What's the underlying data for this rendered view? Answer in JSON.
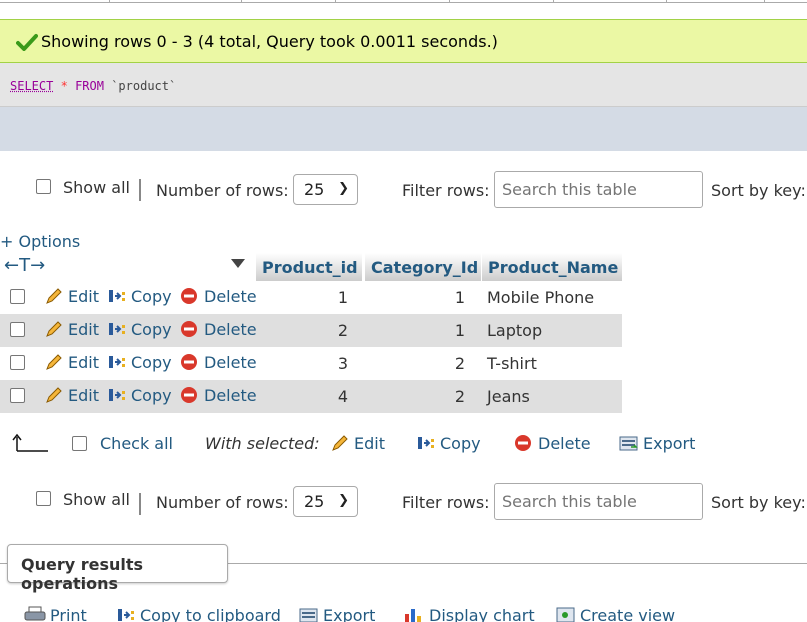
{
  "success": {
    "message": "Showing rows 0 - 3 (4 total, Query took 0.0011 seconds.)",
    "icon": "checkmark-icon"
  },
  "sql": {
    "select": "SELECT",
    "star": "*",
    "from": "FROM",
    "table": "`product`"
  },
  "nav": {
    "show_all": "Show all",
    "rows_label": "Number of rows:",
    "rows_value": "25",
    "filter_label": "Filter rows:",
    "filter_placeholder": "Search this table",
    "sort_label": "Sort by key:"
  },
  "options_link": "+ Options",
  "table": {
    "sort_arrows": "←T→",
    "columns": [
      "Product_id",
      "Category_Id",
      "Product_Name"
    ],
    "actions": {
      "edit": "Edit",
      "copy": "Copy",
      "delete": "Delete"
    },
    "rows": [
      {
        "product_id": "1",
        "category_id": "1",
        "product_name": "Mobile Phone"
      },
      {
        "product_id": "2",
        "category_id": "1",
        "product_name": "Laptop"
      },
      {
        "product_id": "3",
        "category_id": "2",
        "product_name": "T-shirt"
      },
      {
        "product_id": "4",
        "category_id": "2",
        "product_name": "Jeans"
      }
    ]
  },
  "with_selected": {
    "check_all": "Check all",
    "label": "With selected:",
    "edit": "Edit",
    "copy": "Copy",
    "delete": "Delete",
    "export": "Export"
  },
  "query_ops": {
    "title": "Query results operations",
    "print": "Print",
    "copy_clipboard": "Copy to clipboard",
    "export": "Export",
    "display_chart": "Display chart",
    "create_view": "Create view"
  },
  "colors": {
    "link": "#235a81",
    "success_bg": "#ebf8a4",
    "row_alt": "#dfdfdf"
  }
}
